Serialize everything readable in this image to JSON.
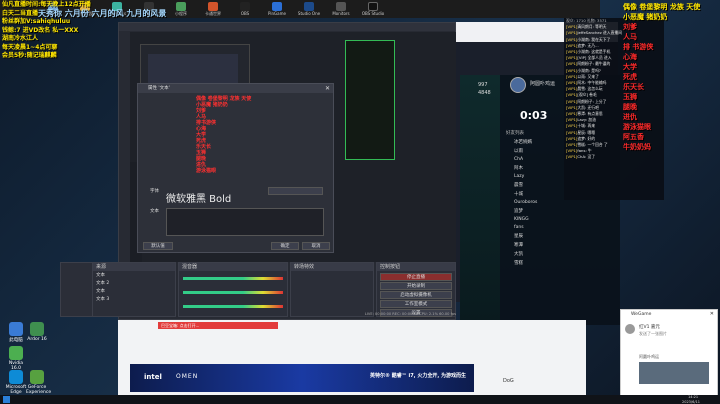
{
  "overlay": {
    "line1": "仙凡直播时间:每天晚上12点开播",
    "line2": "白天二当直播",
    "line3": "粉丝群加V:sahiqhuluu",
    "line4": "钱鲸:7 进VD改名 私一XXX",
    "line5": "湖南冷水江人",
    "line6": "每天凌晨1~4点可聊",
    "line7": "会员5秒:随记瑞麒麟",
    "banner": "天秀你 六月份 六月的风 九月的风景",
    "right_title": "偶像 卷堡黎明 龙族 天使",
    "right_sub": "小恶魔 猪奶奶",
    "right_lines": [
      "刘爹",
      "人马",
      "排 书游侠",
      "心海",
      "大学",
      "死虎",
      "乐天长",
      "玉狮",
      "腿晚",
      "进仇",
      "游泳猫眼",
      "阿五香",
      "牛奶奶妈"
    ]
  },
  "topbar": {
    "apps": [
      "回收站",
      "资源管理器",
      "Vivetools",
      "Obs",
      "小程序",
      "卡通世界",
      "OBS",
      "PinGame",
      "Studio One",
      "Monitors",
      "OBS Studio"
    ]
  },
  "desktop_icons": [
    {
      "label": "此电脑",
      "color": "#3a7bd5"
    },
    {
      "label": "Ardor 16",
      "color": "#3f8f4f"
    },
    {
      "label": "Nvidia 16.0",
      "color": "#4caf50"
    },
    {
      "label": "Microsoft Edge",
      "color": "#0e8bd6"
    },
    {
      "label": "GeForce Experience",
      "color": "#57a140"
    },
    {
      "label": "PS",
      "color": "#2a5fb8"
    }
  ],
  "obs": {
    "dialog_title": "属性 '文本'",
    "dialog_red_lines": [
      "偶像 卷堡黎明 龙族 天使",
      "小恶魔 猪奶奶",
      "刘爹",
      "人马",
      "排书游侠",
      "心海",
      "大学",
      "死虎",
      "乐天长",
      "玉狮",
      "腿晚",
      "进仇",
      "游泳猫眼",
      "阿五香",
      "牛奶奶妈"
    ],
    "font_label": "字体",
    "font_value": "微软雅黑 Bold",
    "text_label": "文本",
    "ok_button": "确定",
    "cancel_button": "取消",
    "defaults_button": "默认值",
    "scenes_header": "场景",
    "sources_header": "来源",
    "mixer_header": "混音器",
    "transitions_header": "转场特效",
    "controls_header": "控制按钮",
    "controls": [
      "停止直播",
      "开始录制",
      "启动虚拟摄像机",
      "工作室模式",
      "设置",
      "退出"
    ],
    "sources": [
      "文本",
      "文本 2",
      "文本",
      "文本 3",
      "浏览器"
    ],
    "status": "LIVE: 00:00:00  REC: 00:00:00  CPU: 2.1%  60.00 fps"
  },
  "game": {
    "score_a": "997",
    "score_b": "4848",
    "timer": "0:03",
    "player_name": "阿圆卟鸡运",
    "friends_header": "好友列表",
    "friends": [
      "冰若婉嫣",
      "以雨",
      "ChA",
      "阿木",
      "Lazy",
      "晨雪",
      "十城",
      "Ouroboros",
      "追梦",
      "KINGG",
      "fans",
      "星辰",
      "寒潭",
      "大凯",
      "雪糕"
    ]
  },
  "chat": {
    "header": "观众: 1710 礼物: 3571",
    "lines": [
      {
        "vip": "[VIP1]",
        "text": "清风朗月: 等明天"
      },
      {
        "vip": "[VIP1]",
        "text": "JeffeSanchez 进入直播间"
      },
      {
        "vip": "[VIP1]",
        "text": "小湖南: 我在天下了"
      },
      {
        "vip": "[VIP1]",
        "text": "追梦: 无乃..."
      },
      {
        "vip": "[VIP1]",
        "text": "小湖南: 这就是手机"
      },
      {
        "vip": "[VIP1]",
        "text": "[VIP] 全部人员 进入"
      },
      {
        "vip": "[VIP1]",
        "text": "阿朗粉子: 最牛逼的"
      },
      {
        "vip": "[VIP1]",
        "text": "小湖南: 是吗?"
      },
      {
        "vip": "[VIP1]",
        "text": "以雨: 又来了"
      },
      {
        "vip": "[VIP1]",
        "text": "阿木: 中午能输吗"
      },
      {
        "vip": "[VIP1]",
        "text": "晨雪: 这怎么玩"
      },
      {
        "vip": "[VIP1]",
        "text": "[观众] 卷毛"
      },
      {
        "vip": "[VIP1]",
        "text": "阿朗粉子: 上分了"
      },
      {
        "vip": "[VIP1]",
        "text": "大凯: 还行吧"
      },
      {
        "vip": "[VIP1]",
        "text": "寒潭: 有点意思"
      },
      {
        "vip": "[VIP1]",
        "text": "Lazy: 加油"
      },
      {
        "vip": "[VIP1]",
        "text": "十城: 再来"
      },
      {
        "vip": "[VIP1]",
        "text": "星辰: 嗯嗯"
      },
      {
        "vip": "[VIP1]",
        "text": "追梦: 好的"
      },
      {
        "vip": "[VIP1]",
        "text": "雪糕: 一个回合 了"
      },
      {
        "vip": "[VIP1]",
        "text": "fans: 牛"
      },
      {
        "vip": "[VIP1]",
        "text": "ChA: 没了"
      }
    ]
  },
  "web": {
    "ad_brand": "intel",
    "ad_game": "OMEN",
    "ad_text": "英特尔® 酷睿™ i7, 火力全开, 为游戏而生",
    "comment_user": "DoG",
    "red_banner": "巴豆宝箱: 点击打开..."
  },
  "popup": {
    "title": "WeGame",
    "user": "红V1 嘉元",
    "message": "发送了一张图片",
    "sub": "阿圆卟鸡运"
  },
  "taskbar": {
    "time": "14:21",
    "date": "2023/6/11"
  },
  "colors": {
    "overlay_yellow": "#ffe600",
    "overlay_red": "#ff2a2a",
    "obs_bg": "#272a33",
    "live_red": "#d02b2b"
  }
}
